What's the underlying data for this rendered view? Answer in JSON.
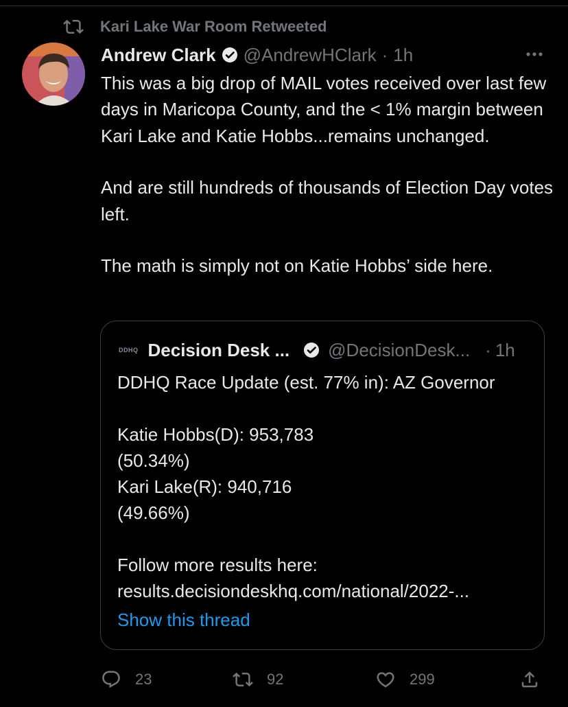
{
  "retweet_banner": {
    "text": "Kari Lake War Room Retweeted"
  },
  "tweet": {
    "author_name": "Andrew Clark",
    "handle": "@AndrewHClark",
    "separator": "·",
    "time": "1h",
    "paragraphs": [
      "This was a big drop of MAIL votes received over last few days in Maricopa County, and the < 1% margin between Kari Lake and Katie Hobbs...remains unchanged.",
      "And are still hundreds of thousands of Election Day votes left.",
      "The math is simply not on Katie Hobbs’ side here."
    ]
  },
  "quoted_tweet": {
    "logo_text": "DDHQ",
    "author_name": "Decision Desk ...",
    "handle": "@DecisionDesk...",
    "separator": "·",
    "time": "1h",
    "lines": [
      "DDHQ Race Update (est. 77% in): AZ Governor",
      "Katie Hobbs(D): 953,783",
      "(50.34%)",
      "Kari Lake(R): 940,716",
      "(49.66%)",
      "Follow more results here:",
      "results.decisiondeskhq.com/national/2022-..."
    ],
    "show_thread": "Show this thread"
  },
  "actions": {
    "replies": "23",
    "retweets": "92",
    "likes": "299"
  },
  "icons": {
    "retweet": "retweet-icon",
    "verified": "verified-badge-icon",
    "more": "more-icon",
    "reply": "reply-icon",
    "like": "heart-icon",
    "share": "share-icon"
  },
  "colors": {
    "background": "#000000",
    "text": "#e7e9ea",
    "muted": "#71767b",
    "link": "#1d9bf0",
    "border": "#3a3f44"
  }
}
